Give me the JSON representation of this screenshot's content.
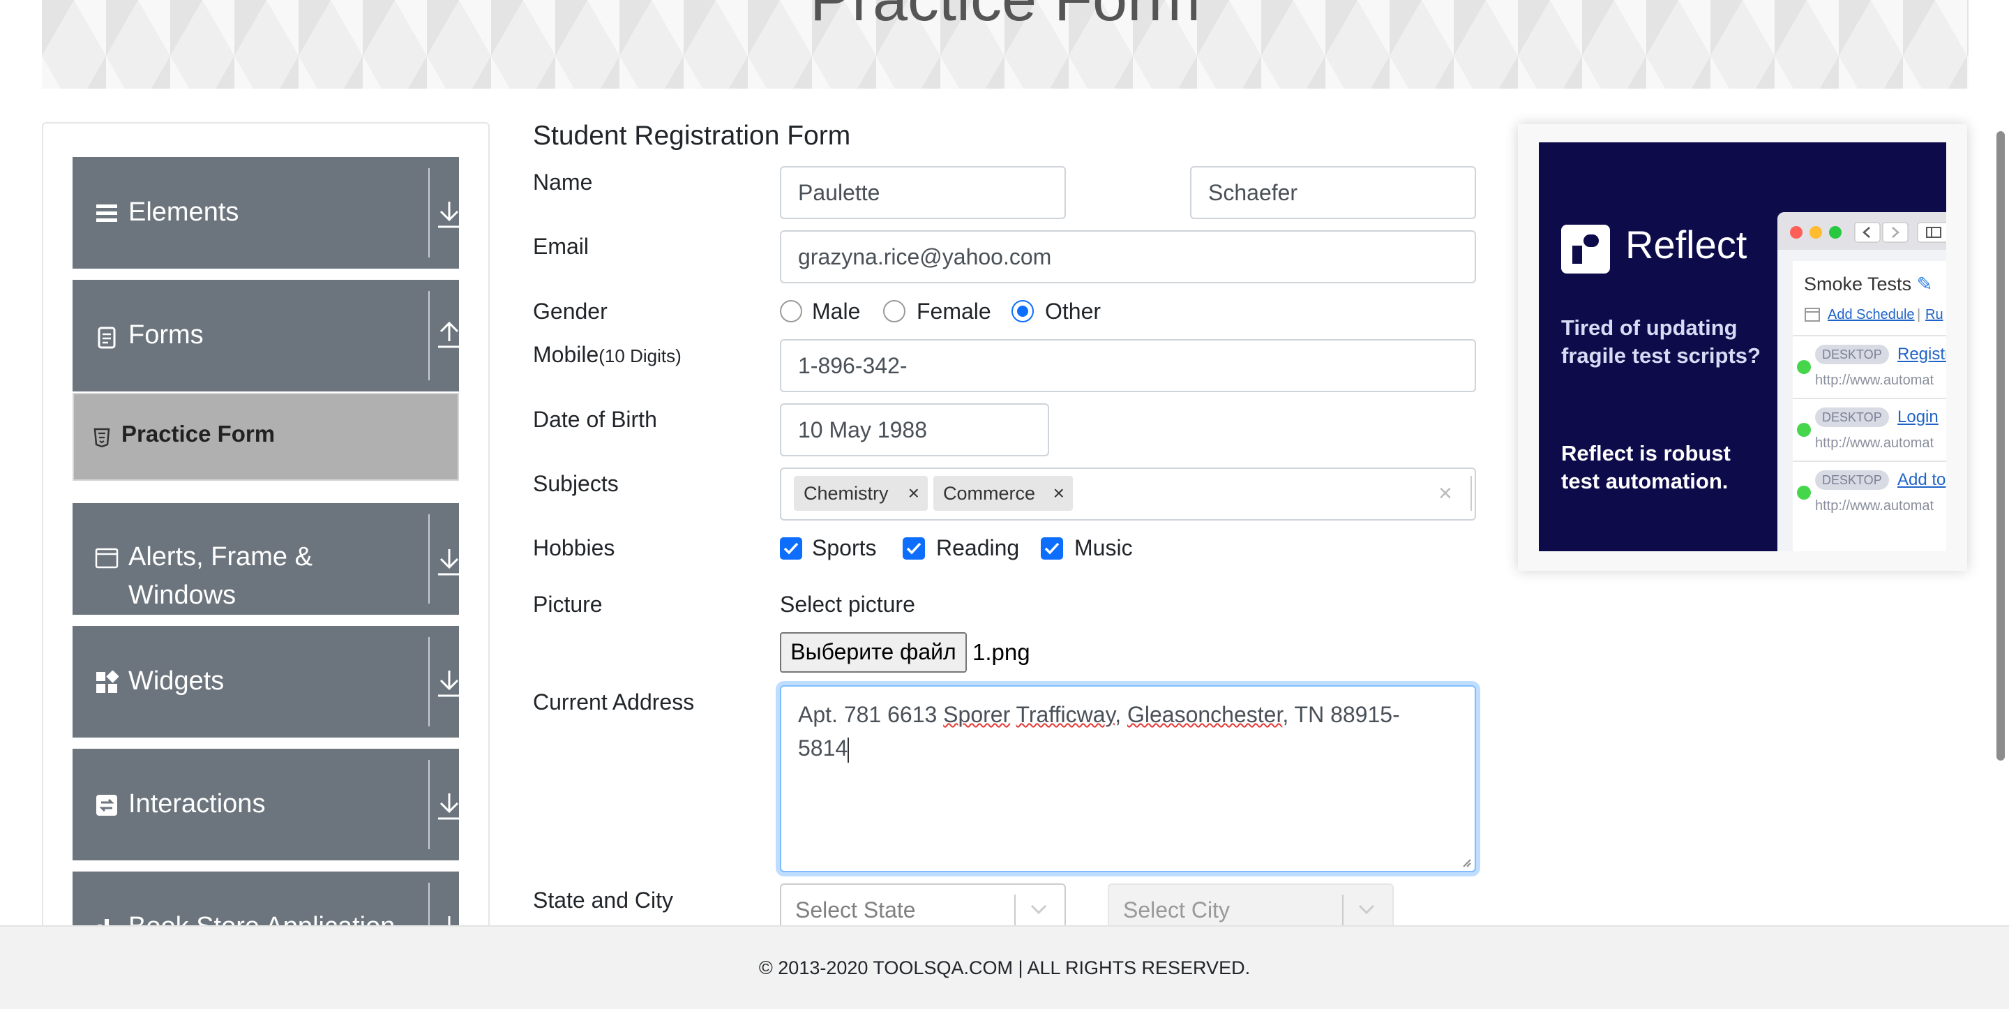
{
  "banner": {
    "title": "Practice Form"
  },
  "sidebar": {
    "groups": [
      {
        "label": "Elements",
        "icon": "list-icon",
        "arrow": "download-arrow-icon"
      },
      {
        "label": "Forms",
        "icon": "document-icon",
        "arrow": "upload-arrow-icon"
      },
      {
        "label_line1": "Alerts, Frame &",
        "label_line2": "Windows",
        "icon": "window-icon",
        "arrow": "download-arrow-icon"
      },
      {
        "label": "Widgets",
        "icon": "widgets-icon",
        "arrow": "download-arrow-icon"
      },
      {
        "label": "Interactions",
        "icon": "interactions-icon",
        "arrow": "download-arrow-icon"
      },
      {
        "label": "Book Store Application",
        "icon": "bookstore-icon",
        "arrow": "download-arrow-icon"
      }
    ],
    "active_item": {
      "label": "Practice Form",
      "icon": "html5-icon"
    }
  },
  "form": {
    "title": "Student Registration Form",
    "name": {
      "label": "Name",
      "first": "Paulette",
      "last": "Schaefer"
    },
    "email": {
      "label": "Email",
      "value": "grazyna.rice@yahoo.com"
    },
    "gender": {
      "label": "Gender",
      "options": [
        "Male",
        "Female",
        "Other"
      ],
      "selected": "Other"
    },
    "mobile": {
      "label": "Mobile",
      "hint": "(10 Digits)",
      "value": "1-896-342-"
    },
    "dob": {
      "label": "Date of Birth",
      "value": "10 May 1988"
    },
    "subjects": {
      "label": "Subjects",
      "tags": [
        "Chemistry",
        "Commerce"
      ],
      "remove_glyph": "×",
      "clear_glyph": "×"
    },
    "hobbies": {
      "label": "Hobbies",
      "options": [
        "Sports",
        "Reading",
        "Music"
      ],
      "checked": [
        true,
        true,
        true
      ]
    },
    "picture": {
      "label": "Picture",
      "caption": "Select picture",
      "button": "Выберите файл",
      "file": "1.png"
    },
    "address": {
      "label": "Current Address",
      "value_start": "Apt. 781 6613 ",
      "word1": "Sporer",
      "space1": " ",
      "word2": "Trafficway",
      "comma": ", ",
      "word3": "Gleasonchester",
      "value_end_line1": ", TN 88915-",
      "value_line2": "5814"
    },
    "state_city": {
      "label": "State and City",
      "state_placeholder": "Select State",
      "city_placeholder": "Select City"
    }
  },
  "ad": {
    "brand": "Reflect",
    "headline": "Tired of updating fragile test scripts?",
    "tagline": "Reflect is robust test automation.",
    "window": {
      "title": "Smoke Tests",
      "schedule_link": "Add Schedule",
      "separator": "|",
      "run_link": "Ru",
      "rows": [
        {
          "badge": "DESKTOP",
          "link": "Registr",
          "url": "http://www.automat"
        },
        {
          "badge": "DESKTOP",
          "link": "Login",
          "url": "http://www.automat"
        },
        {
          "badge": "DESKTOP",
          "link": "Add to",
          "url": "http://www.automat"
        }
      ]
    },
    "colors": {
      "background": "#0d0b4a",
      "status": "#45d64b"
    }
  },
  "footer": {
    "text": "© 2013-2020 TOOLSQA.COM | ALL RIGHTS RESERVED."
  },
  "colors": {
    "accent": "#0d6efd",
    "sidebar_group": "#6c757d",
    "sidebar_active": "#b0b0b0"
  }
}
